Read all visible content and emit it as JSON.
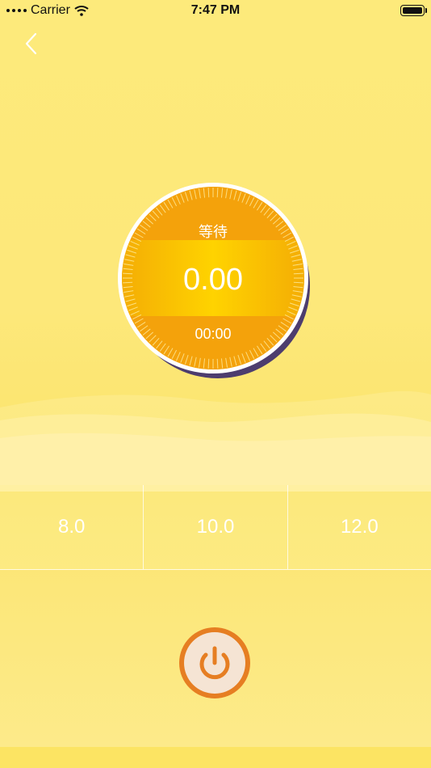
{
  "status_bar": {
    "carrier": "Carrier",
    "time": "7:47 PM"
  },
  "gauge": {
    "status": "等待",
    "value": "0.00",
    "time": "00:00"
  },
  "options": [
    {
      "label": "8.0"
    },
    {
      "label": "10.0"
    },
    {
      "label": "12.0"
    }
  ],
  "icons": {
    "back": "chevron-left-icon",
    "power": "power-icon",
    "wifi": "wifi-icon",
    "battery": "battery-icon"
  },
  "colors": {
    "background": "#fde87a",
    "gauge_orange": "#f4a20b",
    "gauge_yellow": "#ffd300",
    "power_ring": "#e67e22"
  }
}
